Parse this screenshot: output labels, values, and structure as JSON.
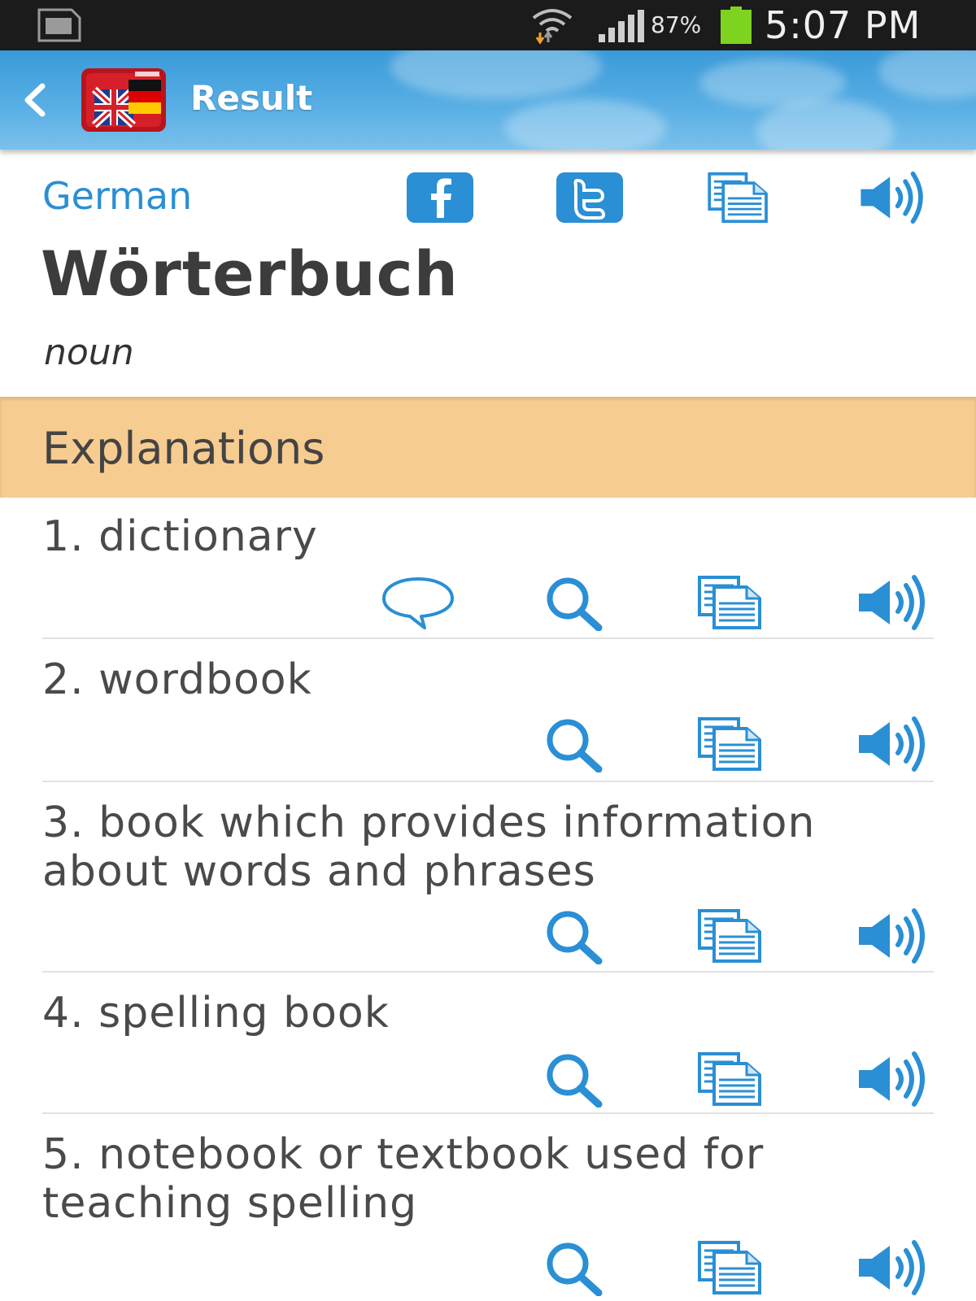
{
  "status_bar": {
    "battery_percent": "87%",
    "time": "5:07 PM",
    "icons": [
      "sim-card-icon",
      "wifi-icon",
      "signal-icon",
      "battery-icon"
    ]
  },
  "action_bar": {
    "title": "Result",
    "icons": [
      "back-icon",
      "app-logo-icon"
    ]
  },
  "header": {
    "language": "German",
    "word": "Wörterbuch",
    "part_of_speech": "noun",
    "icons": [
      "facebook-icon",
      "twitter-icon",
      "copy-icon",
      "speaker-icon"
    ]
  },
  "explanations": {
    "title": "Explanations",
    "items": [
      {
        "text": "1. dictionary",
        "icons": [
          "chat-icon",
          "search-icon",
          "copy-icon",
          "speaker-icon"
        ]
      },
      {
        "text": "2. wordbook",
        "icons": [
          "search-icon",
          "copy-icon",
          "speaker-icon"
        ]
      },
      {
        "text": "3. book which provides information about words and phrases",
        "icons": [
          "search-icon",
          "copy-icon",
          "speaker-icon"
        ]
      },
      {
        "text": "4. spelling book",
        "icons": [
          "search-icon",
          "copy-icon",
          "speaker-icon"
        ]
      },
      {
        "text": "5. notebook or textbook used for teaching spelling",
        "icons": [
          "search-icon",
          "copy-icon",
          "speaker-icon"
        ]
      }
    ]
  },
  "colors": {
    "accent_blue": "#2a8fd4",
    "section_header_bg": "#f7cc91",
    "action_bar_bg": "#4aa6e0",
    "status_bar_bg": "#1b1b1b"
  }
}
